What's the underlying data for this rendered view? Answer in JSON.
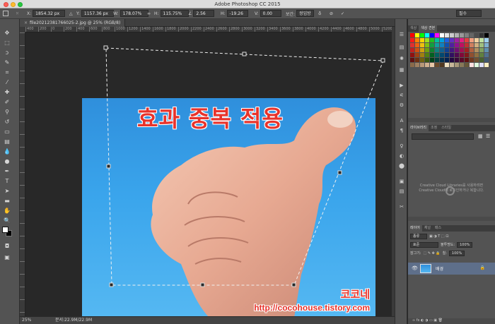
{
  "window": {
    "title": "Adobe Photoshop CC 2015"
  },
  "options_bar": {
    "x_label": "X:",
    "x_value": "1854.32 px",
    "y_label": "Y:",
    "y_value": "1157.36 px",
    "w_label": "W:",
    "w_value": "178.07%",
    "h_label": "H:",
    "h_value": "115.75%",
    "angle_value": "2.56",
    "hskew_label": "H:",
    "hskew_value": "-19.26",
    "vskew_label": "V:",
    "vskew_value": "0.00",
    "interp_label": "보간:",
    "interp_value": "쌍입방",
    "right_select": "필수"
  },
  "document": {
    "tab_label": "file20212381766025-2.jpg @ 25% (RGB/8)",
    "ruler_ticks": [
      "400",
      "200",
      "0",
      "200",
      "400",
      "600",
      "800",
      "1000",
      "1200",
      "1400",
      "1600",
      "1800",
      "2000",
      "2200",
      "2400",
      "2600",
      "2800",
      "3000",
      "3200",
      "3400",
      "3600",
      "3800",
      "4000",
      "4200",
      "4400",
      "4600",
      "4800",
      "5000",
      "5200",
      "5400"
    ]
  },
  "canvas": {
    "headline": "효과 중복 적용",
    "watermark_name": "코코네",
    "watermark_url": "http://cocohouse.tistory.com"
  },
  "status_bar": {
    "zoom": "25%",
    "doc_info": "문서:22.9M/22.9M"
  },
  "panels": {
    "swatch_tabs": [
      "색상",
      "색상 견본"
    ],
    "library_tabs": [
      "라이브러리",
      "조정",
      "스타일"
    ],
    "cc_message_line1": "Creative Cloud Libraries를 사용하려면",
    "cc_message_line2": "Creative Cloud에 로그인하거나 복합니다.",
    "layer_tabs": [
      "레이어",
      "채널",
      "패스"
    ],
    "kind_filter": "종류",
    "blend_mode": "표준",
    "opacity_label": "불투명도:",
    "opacity_value": "100%",
    "lock_label": "잠그기:",
    "fill_label": "칠:",
    "fill_value": "100%",
    "layer_name": "배경"
  },
  "colors": {
    "accent_red": "#e8332b",
    "sky_blue": "#3aa5ec",
    "swatches": [
      "#ff0000",
      "#ffff00",
      "#00ff00",
      "#00ffff",
      "#0000ff",
      "#ff00ff",
      "#ffffff",
      "#e6e6e6",
      "#cccccc",
      "#b3b3b3",
      "#999999",
      "#808080",
      "#666666",
      "#4d4d4d",
      "#333333",
      "#000000",
      "#ff1a1a",
      "#ff8000",
      "#ffd400",
      "#a0e020",
      "#20c020",
      "#00c0a0",
      "#00a0e0",
      "#2060e0",
      "#6030c0",
      "#a020a0",
      "#e02080",
      "#e04040",
      "#f0a080",
      "#f0d0a0",
      "#c0e0a0",
      "#a0d0f0",
      "#e03030",
      "#f06010",
      "#f0c010",
      "#80c010",
      "#10a040",
      "#10a0a0",
      "#1080c0",
      "#1050b0",
      "#5020a0",
      "#901090",
      "#c01060",
      "#c03030",
      "#d08060",
      "#d0b080",
      "#a0c080",
      "#80b0d0",
      "#c02020",
      "#d05010",
      "#d0a010",
      "#70a010",
      "#108030",
      "#108080",
      "#106090",
      "#104090",
      "#401880",
      "#701070",
      "#a01050",
      "#a02020",
      "#b06040",
      "#b09060",
      "#80a060",
      "#6090b0",
      "#901010",
      "#a04010",
      "#a08010",
      "#508010",
      "#006020",
      "#006060",
      "#004870",
      "#003070",
      "#301060",
      "#500850",
      "#800838",
      "#801818",
      "#905030",
      "#907040",
      "#608040",
      "#507090",
      "#601010",
      "#703010",
      "#706010",
      "#385810",
      "#004018",
      "#004040",
      "#003050",
      "#002050",
      "#200840",
      "#380838",
      "#580828",
      "#601010",
      "#703820",
      "#705030",
      "#486030",
      "#405870",
      "#8a6a4a",
      "#a08060",
      "#b89878",
      "#d0b090",
      "#e8c8a8",
      "#6a4a2a",
      "#503820",
      "#f0e0c0",
      "#c8b89a",
      "#a89878",
      "#887858",
      "#685838",
      "#ffe0e0",
      "#e0ffe0",
      "#e0e0ff",
      "#fff0c0"
    ]
  }
}
